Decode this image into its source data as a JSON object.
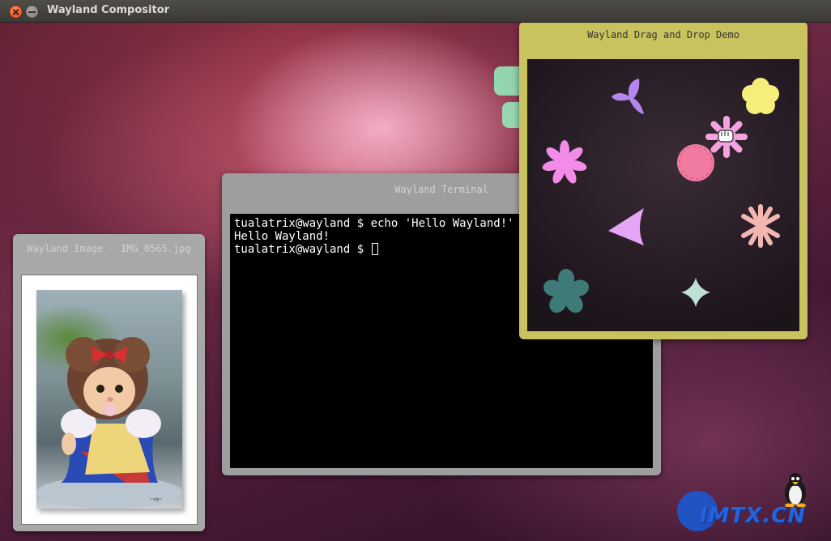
{
  "host": {
    "title": "Wayland Compositor",
    "buttons": [
      "close-icon",
      "minimize-icon"
    ]
  },
  "image_window": {
    "title": "Wayland Image - IMG_0565.jpg"
  },
  "terminal_window": {
    "title": "Wayland Terminal",
    "lines": [
      "tualatrix@wayland $ echo 'Hello Wayland!'",
      "Hello Wayland!",
      "tualatrix@wayland $ "
    ]
  },
  "dnd_window": {
    "title": "Wayland Drag and Drop Demo",
    "items": [
      {
        "name": "propeller-icon",
        "color": "#b585f0"
      },
      {
        "name": "flower-icon",
        "color": "#f5ee7a"
      },
      {
        "name": "asterisk-icon",
        "color": "#f28ce8"
      },
      {
        "name": "gear-flower-icon",
        "color": "#f5a3e0"
      },
      {
        "name": "round-blob-icon",
        "color": "#f07aa0"
      },
      {
        "name": "arrow-icon",
        "color": "#e7a6f5"
      },
      {
        "name": "asterisk-icon",
        "color": "#f2b7b0"
      },
      {
        "name": "flower-icon",
        "color": "#3e7a78"
      },
      {
        "name": "star-icon",
        "color": "#bfe0d5"
      },
      {
        "name": "flower-icon",
        "color": "#94f0c0"
      }
    ]
  },
  "watermark": {
    "text": "IMTX.CN"
  }
}
